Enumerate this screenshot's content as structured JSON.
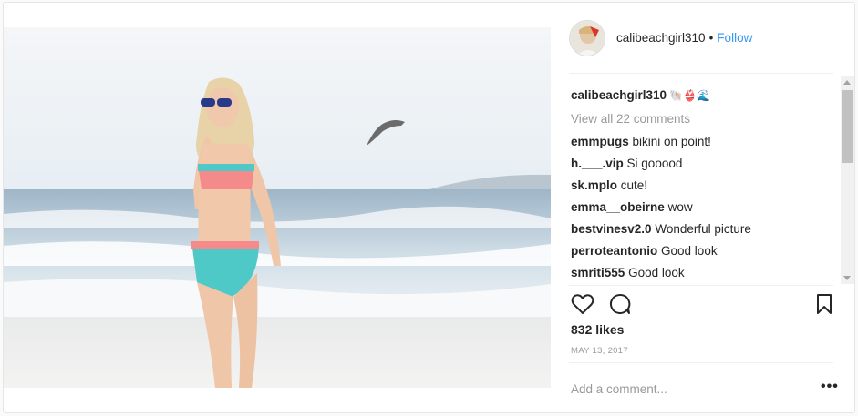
{
  "post": {
    "username": "calibeachgirl310",
    "dot": "•",
    "follow_label": "Follow",
    "caption_user": "calibeachgirl310",
    "caption_emoji": "🐚👙🌊",
    "view_all": "View all 22 comments",
    "comments": [
      {
        "user": "emmpugs",
        "text": "bikini on point!"
      },
      {
        "user": "h.___.vip",
        "text": "Si gooood"
      },
      {
        "user": "sk.mplo",
        "text": "cute!"
      },
      {
        "user": "emma__obeirne",
        "text": "wow"
      },
      {
        "user": "bestvinesv2.0",
        "text": "Wonderful picture"
      },
      {
        "user": "perroteantonio",
        "text": "Good look"
      },
      {
        "user": "smriti555",
        "text": "Good look"
      }
    ],
    "likes": "832 likes",
    "date": "MAY 13, 2017",
    "add_comment_placeholder": "Add a comment...",
    "more_label": "•••"
  },
  "icons": {
    "like": "heart-icon",
    "comment": "comment-bubble-icon",
    "save": "bookmark-icon",
    "more": "more-options-icon"
  },
  "colors": {
    "link": "#3897f0",
    "muted": "#999999",
    "text": "#262626"
  }
}
